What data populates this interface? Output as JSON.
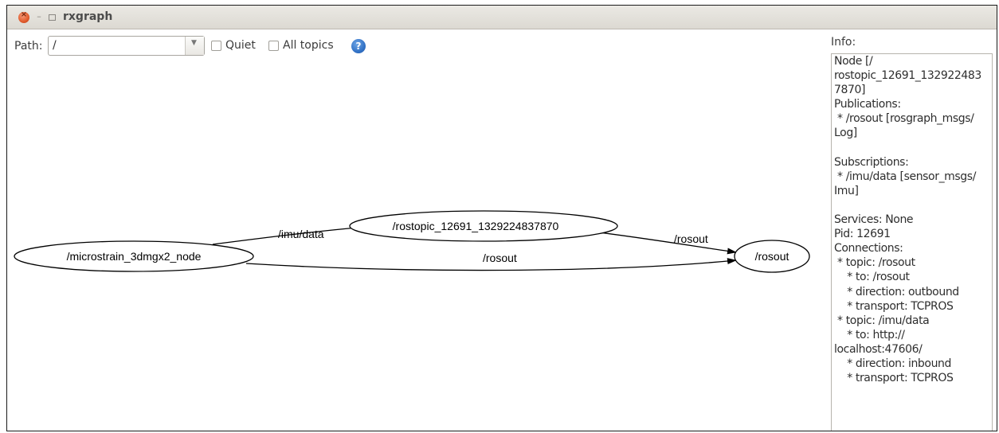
{
  "window": {
    "title": "rxgraph"
  },
  "toolbar": {
    "path_label": "Path:",
    "path_value": "/",
    "quiet_label": "Quiet",
    "quiet_checked": false,
    "all_topics_label": "All topics",
    "all_topics_checked": false,
    "help_icon": "?"
  },
  "graph": {
    "nodes": [
      {
        "name": "microstrain-node",
        "label": "/microstrain_3dmgx2_node"
      },
      {
        "name": "rostopic-node",
        "label": "/rostopic_12691_1329224837870"
      },
      {
        "name": "rosout-node",
        "label": "/rosout"
      }
    ],
    "edges": [
      {
        "from": "/microstrain_3dmgx2_node",
        "to": "/rostopic_12691_1329224837870",
        "label": "/imu/data"
      },
      {
        "from": "/rostopic_12691_1329224837870",
        "to": "/rosout",
        "label": "/rosout"
      },
      {
        "from": "/microstrain_3dmgx2_node",
        "to": "/rosout",
        "label": "/rosout"
      }
    ]
  },
  "info": {
    "label": "Info:",
    "lines": [
      "Node [/",
      "rostopic_12691_132922483",
      "7870]",
      "Publications:",
      " * /rosout [rosgraph_msgs/",
      "Log]",
      "",
      "Subscriptions:",
      " * /imu/data [sensor_msgs/",
      "Imu]",
      "",
      "Services: None",
      "Pid: 12691",
      "Connections:",
      " * topic: /rosout",
      "    * to: /rosout",
      "    * direction: outbound",
      "    * transport: TCPROS",
      " * topic: /imu/data",
      "    * to: http://",
      "localhost:47606/",
      "    * direction: inbound",
      "    * transport: TCPROS"
    ]
  }
}
